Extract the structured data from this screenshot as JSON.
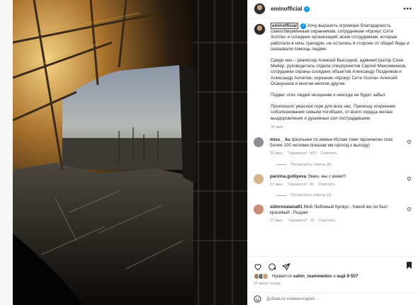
{
  "post": {
    "username": "eminofficial",
    "more_label": "•••",
    "caption_user": "eminofficial",
    "caption_intro": " Хочу выразить огромную благодарность самоотверженным охранникам, сотрудникам «Крокус Сити Холла» и соседних организаций, всем сотрудникам, которые работали в ночь трагедии, не остались в стороне от общей беды и оказывали помощь людям.",
    "caption_p2": "Среди них – режиссер Алексей Высоцкий, администратор Соня Мейер, руководитель отдела спецпроектов Сергей Максименков, сотрудники охраны соседних объектов Александр Позднякoв и Александр Антипов, охранник «Крокус Сити Холла» Алексей Осанушков и многие-многие другие.",
    "caption_p3": "Подвиг этих людей неоценим и никогда не будет забыт.",
    "caption_p4": "Произошло ужасное горе для всех нас. Приношу искренние соболезнования семьям погибших, от всего сердца желаю выздоровления и душевных сил пострадавшим.",
    "caption_time": "35 мин."
  },
  "comments": [
    {
      "user": "miss__ku",
      "text": "Школьник по имени Ислам тоже героически спас более 100 человек,показав им проход к выходу)",
      "time": "20 мин.",
      "likes": "\"Нравится\": 437",
      "reply": "Ответить",
      "replies_label": "Посмотреть ответы (8)",
      "avatar_color": "#8a8f96"
    },
    {
      "user": "parvina.gulliyeva",
      "text": "Эмин, мы с вами!!!",
      "time": "17 мин.",
      "likes": "\"Нравится\": 81",
      "reply": "Ответить",
      "replies_label": "Посмотреть ответы (3)",
      "avatar_color": "#d6b48c"
    },
    {
      "user": "sidorovaiana91",
      "text": "Мой Любимый Крокус . Какой же он был красивый . Рыдаю",
      "time": "17 мин.",
      "likes": "\"Нравится\": 29",
      "reply": "Ответить",
      "replies_label": "",
      "avatar_color": "#c98d77"
    }
  ],
  "likes": {
    "prefix": "Нравится ",
    "user": "sahin_mammedov",
    "middle": " и ",
    "count": "ещё 9 557"
  },
  "posted": "25 минут назад",
  "comment_input": {
    "placeholder": "Добавьте комментарий..."
  },
  "colors": {
    "verified": "#0095f6",
    "secondary_text": "#8e8e8e",
    "primary_text": "#262626"
  },
  "icons": [
    "more-icon",
    "heart-icon",
    "comment-icon",
    "share-icon",
    "bookmark-icon",
    "smile-icon",
    "verified-icon"
  ]
}
